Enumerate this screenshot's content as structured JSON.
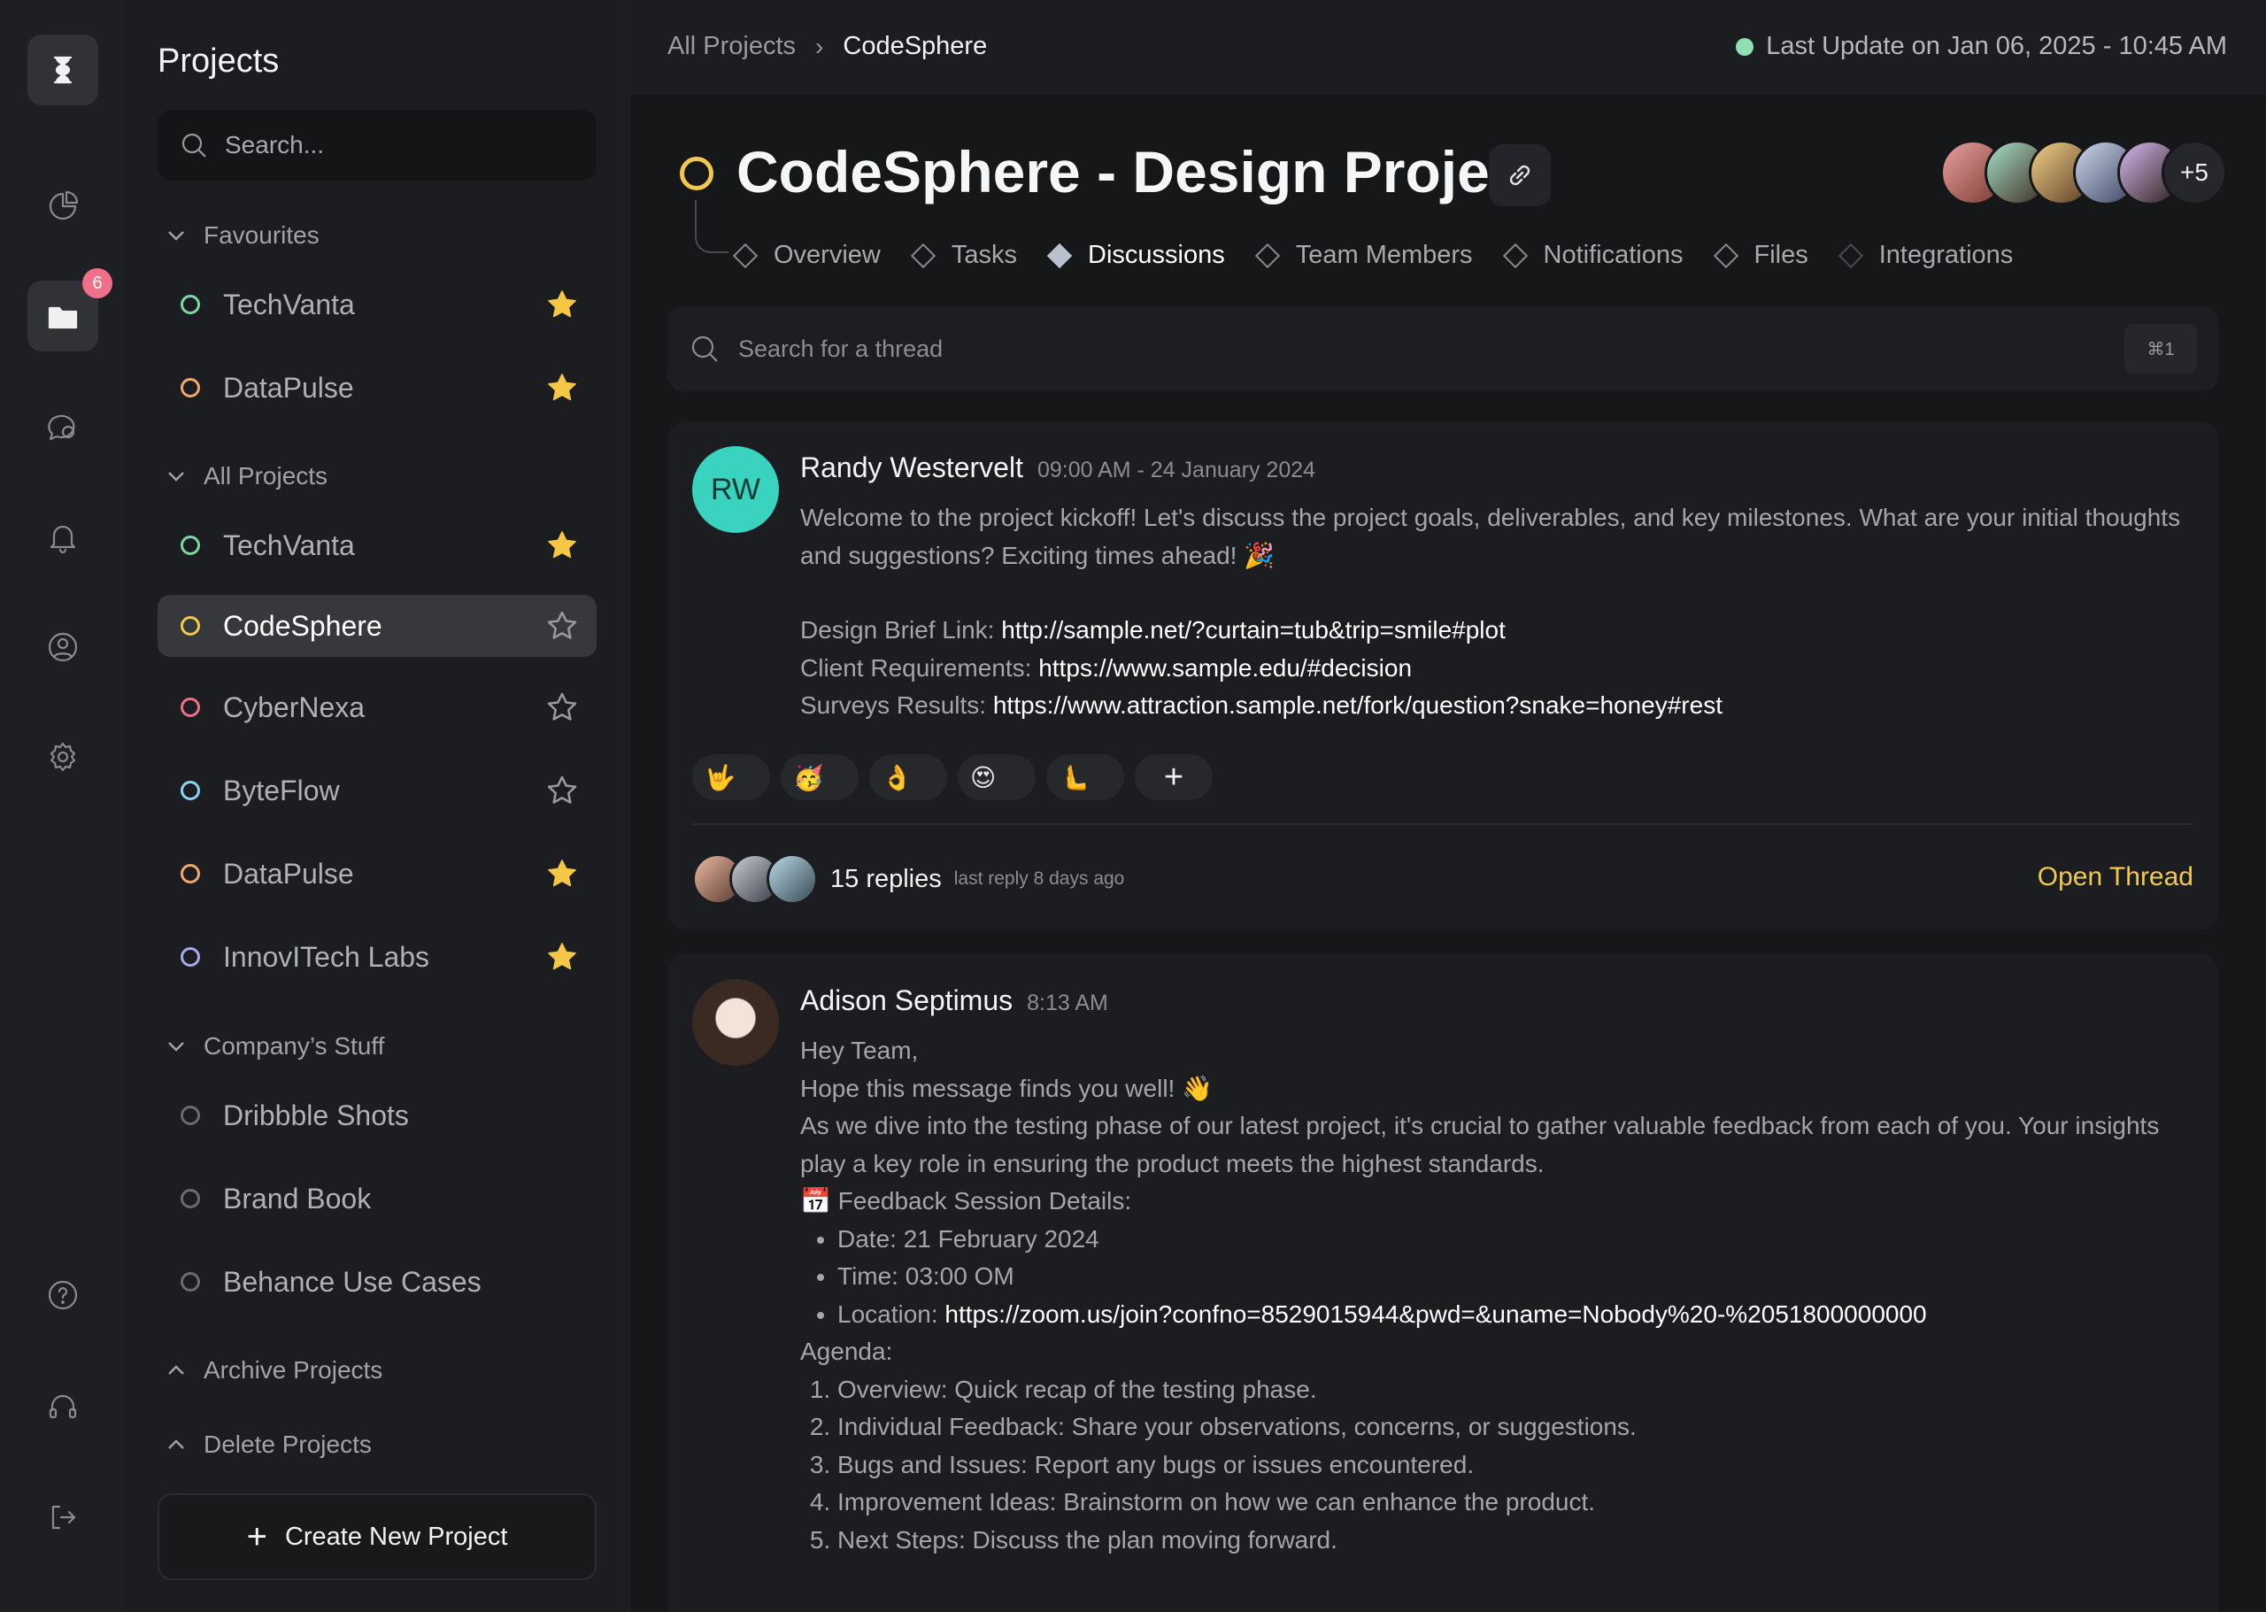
{
  "rail": {
    "badge_count": "6"
  },
  "sidebar": {
    "title": "Projects",
    "search_placeholder": "Search...",
    "groups": {
      "favourites": "Favourites",
      "all_projects": "All Projects",
      "company": "Company’s Stuff",
      "archive": "Archive Projects",
      "delete": "Delete Projects"
    },
    "favourites": [
      {
        "name": "TechVanta",
        "color": "#7fd6a4",
        "starred": true
      },
      {
        "name": "DataPulse",
        "color": "#f2a86b",
        "starred": true
      }
    ],
    "all_projects": [
      {
        "name": "TechVanta",
        "color": "#7fd6a4",
        "starred": true
      },
      {
        "name": "CodeSphere",
        "color": "#f2c94c",
        "starred": false,
        "active": true
      },
      {
        "name": "CyberNexa",
        "color": "#f0708a",
        "starred": false
      },
      {
        "name": "ByteFlow",
        "color": "#8fd3f0",
        "starred": false
      },
      {
        "name": "DataPulse",
        "color": "#f2a86b",
        "starred": true
      },
      {
        "name": "InnovITech Labs",
        "color": "#a9a8f2",
        "starred": true
      }
    ],
    "company": [
      {
        "name": "Dribbble Shots",
        "color": "#6a6b70"
      },
      {
        "name": "Brand Book",
        "color": "#6a6b70"
      },
      {
        "name": "Behance Use Cases",
        "color": "#6a6b70"
      }
    ],
    "create_label": "Create New Project"
  },
  "topbar": {
    "crumb_all": "All Projects",
    "crumb_current": "CodeSphere",
    "last_update": "Last Update on Jan 06, 2025 - 10:45 AM"
  },
  "project": {
    "title": "CodeSphere - Design Project",
    "members_more": "+5",
    "tabs": [
      "Overview",
      "Tasks",
      "Discussions",
      "Team Members",
      "Notifications",
      "Files",
      "Integrations"
    ],
    "active_tab": "Discussions"
  },
  "thread_search": {
    "placeholder": "Search for a thread",
    "shortcut": "⌘1"
  },
  "posts": [
    {
      "initials": "RW",
      "author": "Randy Westervelt",
      "time": "09:00 AM - 24 January 2024",
      "text1": "Welcome to the project kickoff! Let's discuss the project goals, deliverables, and key milestones. What are your initial thoughts and suggestions? Exciting times ahead! 🎉",
      "brief_label": "Design Brief Link: ",
      "brief_url": "http://sample.net/?curtain=tub&trip=smile#plot",
      "req_label": "Client Requirements: ",
      "req_url": "https://www.sample.edu/#decision",
      "survey_label": "Surveys Results: ",
      "survey_url": "https://www.attraction.sample.net/fork/question?snake=honey#rest",
      "reactions": [
        "🤟",
        "🥳",
        "👌",
        "😍",
        "🫷"
      ],
      "replies": "15 replies",
      "last_reply": "last reply 8 days ago",
      "open_label": "Open Thread"
    },
    {
      "author": "Adison Septimus",
      "time": "8:13 AM",
      "l1": "Hey Team,",
      "l2": "Hope this message finds you well! 👋",
      "l3": "As we dive into the testing phase of our latest project, it's crucial to gather valuable feedback from each of you. Your insights play a key role in ensuring the product meets the highest standards.",
      "l4": "📅 Feedback Session Details:",
      "date": "Date: 21 February 2024",
      "time_item": "Time: 03:00 OM",
      "loc_label": "Location: ",
      "loc_url": "https://zoom.us/join?confno=8529015944&pwd=&uname=Nobody%20-%2051800000000",
      "agenda": "Agenda:",
      "items": [
        "Overview: Quick recap of the testing phase.",
        "Individual Feedback: Share your observations, concerns, or suggestions.",
        "Bugs and Issues: Report any bugs or issues encountered.",
        "Improvement Ideas: Brainstorm on how we can enhance the product.",
        "Next Steps: Discuss the plan moving forward."
      ]
    }
  ]
}
